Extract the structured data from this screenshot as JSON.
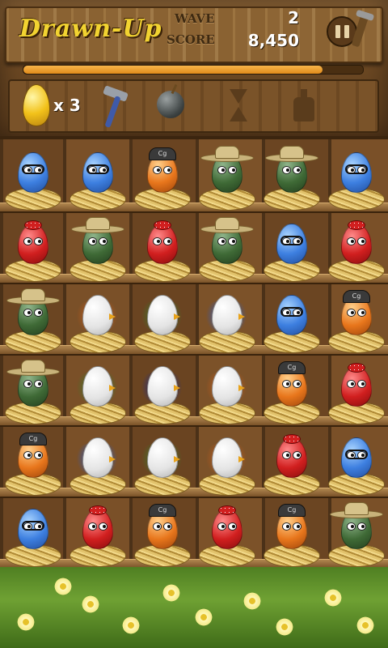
{
  "header": {
    "title": "Drawn-Up",
    "wave_label": "WAVE",
    "wave_value": "2",
    "score_label": "SCORE",
    "score_value": "8,450",
    "progress_fraction": 0.88
  },
  "tools": {
    "golden_egg_count_prefix": "x",
    "golden_egg_count": "3",
    "items": [
      "golden-egg-icon",
      "hammer-icon",
      "bomb-icon",
      "hourglass-icon",
      "bottle-icon"
    ]
  },
  "grid": {
    "rows": [
      [
        {
          "egg": "blue",
          "acc": "glasses"
        },
        {
          "egg": "blue",
          "acc": "glasses"
        },
        {
          "egg": "orange",
          "acc": "cap",
          "cap": "Cg"
        },
        {
          "egg": "green",
          "acc": "cowboy"
        },
        {
          "egg": "green",
          "acc": "cowboy"
        },
        {
          "egg": "blue",
          "acc": "glasses"
        }
      ],
      [
        {
          "egg": "red",
          "acc": "bow"
        },
        {
          "egg": "green",
          "acc": "cowboy"
        },
        {
          "egg": "red",
          "acc": "bow"
        },
        {
          "egg": "green",
          "acc": "cowboy"
        },
        {
          "egg": "blue",
          "acc": "glasses"
        },
        {
          "egg": "red",
          "acc": "bow"
        }
      ],
      [
        {
          "egg": "green",
          "acc": "cowboy"
        },
        {
          "egg": "white",
          "acc": "splat",
          "splat": "orange"
        },
        {
          "egg": "white",
          "acc": "splat",
          "splat": "green"
        },
        {
          "egg": "white",
          "acc": "splat",
          "splat": "blue"
        },
        {
          "egg": "blue",
          "acc": "glasses"
        },
        {
          "egg": "orange",
          "acc": "cap",
          "cap": "Cg"
        }
      ],
      [
        {
          "egg": "green",
          "acc": "cowboy"
        },
        {
          "egg": "white",
          "acc": "splat",
          "splat": "green"
        },
        {
          "egg": "white",
          "acc": "splat",
          "splat": "navy"
        },
        {
          "egg": "white",
          "acc": "splat",
          "splat": "orange"
        },
        {
          "egg": "orange",
          "acc": "cap",
          "cap": "Cg"
        },
        {
          "egg": "red",
          "acc": "bow"
        }
      ],
      [
        {
          "egg": "orange",
          "acc": "cap",
          "cap": "Cg"
        },
        {
          "egg": "white",
          "acc": "splat",
          "splat": "blue"
        },
        {
          "egg": "white",
          "acc": "splat",
          "splat": "green"
        },
        {
          "egg": "white",
          "acc": "splat",
          "splat": "orange"
        },
        {
          "egg": "red",
          "acc": "bow"
        },
        {
          "egg": "blue",
          "acc": "glasses"
        }
      ],
      [
        {
          "egg": "blue",
          "acc": "glasses"
        },
        {
          "egg": "red",
          "acc": "bow"
        },
        {
          "egg": "orange",
          "acc": "cap",
          "cap": "Cg"
        },
        {
          "egg": "red",
          "acc": "bow"
        },
        {
          "egg": "orange",
          "acc": "cap",
          "cap": "Cg"
        },
        {
          "egg": "green",
          "acc": "cowboy"
        }
      ]
    ]
  },
  "colors": {
    "title": "#f2d331",
    "progress": "#e08a1a",
    "wood": "#6b4522"
  }
}
